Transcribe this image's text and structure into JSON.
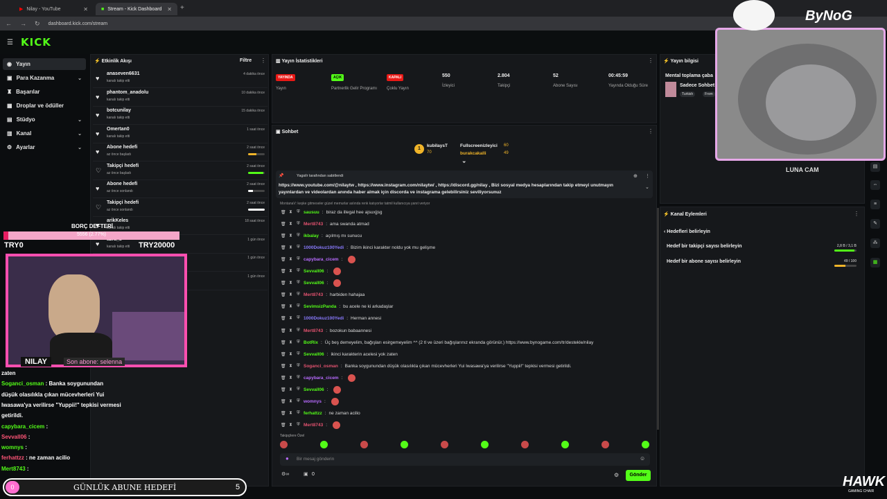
{
  "browser": {
    "tabs": [
      {
        "label": "Nilay - YouTube",
        "active": false
      },
      {
        "label": "Stream - Kick Dashboard",
        "active": true
      }
    ],
    "address": "dashboard.kick.com/stream"
  },
  "brand": {
    "logo": "KICK",
    "accent": "#53fc18"
  },
  "sidebar": {
    "items": [
      {
        "label": "Yayın",
        "icon": "broadcast-icon",
        "active": true,
        "chevron": false
      },
      {
        "label": "Para Kazanma",
        "icon": "dollar-icon",
        "chevron": true
      },
      {
        "label": "Başarılar",
        "icon": "trophy-icon",
        "chevron": false
      },
      {
        "label": "Droplar ve ödüller",
        "icon": "gift-icon",
        "chevron": false
      },
      {
        "label": "Stüdyo",
        "icon": "studio-icon",
        "chevron": true
      },
      {
        "label": "Kanal",
        "icon": "channel-icon",
        "chevron": true
      },
      {
        "label": "Ayarlar",
        "icon": "gear-icon",
        "chevron": true
      }
    ]
  },
  "activity": {
    "title": "Etkinlik Akışı",
    "filter": "Filtre",
    "items": [
      {
        "name": "anaseven6631",
        "sub": "kanalı takip etti",
        "time": "4 dakika önce",
        "icon": "heart-icon"
      },
      {
        "name": "phantom_anadolu",
        "sub": "kanalı takip etti",
        "time": "10 dakika önce",
        "icon": "heart-icon"
      },
      {
        "name": "botcunilay",
        "sub": "kanalı takip etti",
        "time": "15 dakika önce",
        "icon": "heart-icon"
      },
      {
        "name": "Omertan0",
        "sub": "kanalı takip etti",
        "time": "1 saat önce",
        "icon": "heart-icon"
      },
      {
        "name": "Abone hedefi",
        "sub": "az önce başladı",
        "time": "2 saat önce",
        "icon": "heart-icon",
        "progress": 0.5,
        "color": "#f0b429"
      },
      {
        "name": "Takipçi hedefi",
        "sub": "az önce başladı",
        "time": "2 saat önce",
        "icon": "heart-outline-icon",
        "progress": 0.9,
        "color": "#53fc18"
      },
      {
        "name": "Abone hedefi",
        "sub": "az önce sonlandı",
        "time": "2 saat önce",
        "icon": "heart-icon",
        "progress": 0.3,
        "color": "#ffffff"
      },
      {
        "name": "Takipçi hedefi",
        "sub": "az önce sonlandı",
        "time": "2 saat önce",
        "icon": "heart-outline-icon",
        "progress": 1.0,
        "color": "#ffffff"
      },
      {
        "name": "arikKeles",
        "sub": "kanalı takip etti",
        "time": "18 saat önce",
        "icon": "heart-icon"
      },
      {
        "name": "azra_s",
        "sub": "kanalı takip etti",
        "time": "1 gün önce",
        "icon": "heart-icon"
      },
      {
        "name": "",
        "sub": "",
        "time": "1 gün önce",
        "icon": "heart-icon"
      },
      {
        "name": "",
        "sub": "",
        "time": "1 gün önce",
        "icon": "heart-icon"
      }
    ]
  },
  "stats": {
    "title": "Yayın İstatistikleri",
    "items": [
      {
        "value": "YAYINDA",
        "label": "Yayın",
        "badge": true,
        "color": "#e91916"
      },
      {
        "value": "AÇIK",
        "label": "Partnerlik Gelir Programı",
        "badge": true,
        "color": "#53fc18"
      },
      {
        "value": "KAPALI",
        "label": "Çoklu Yayın",
        "badge": true,
        "color": "#e91916"
      },
      {
        "value": "550",
        "label": "İzleyici"
      },
      {
        "value": "2.804",
        "label": "Takipçi"
      },
      {
        "value": "52",
        "label": "Abone Sayısı"
      },
      {
        "value": "00:45:59",
        "label": "Yayında Olduğu Süre"
      }
    ]
  },
  "info": {
    "title": "Yayın bilgisi",
    "stream_title": "Mental toplama çaba",
    "category": "Sadece Sohbet",
    "tags": [
      "Turkish",
      "From"
    ]
  },
  "chat": {
    "title": "Sohbet",
    "leaderboard": [
      {
        "name": "kubilaysT",
        "count": "70"
      },
      {
        "name": "Fullscreenizleyici",
        "count": "60"
      },
      {
        "name": "burakcakalli",
        "count": "49"
      }
    ],
    "pinned_by": "Yagsilr tarafından sabitlendi",
    "pinned_text": "https://www.youtube.com/@nilaytw , https://www.instagram.com/nilaytw/ , https://discord.gg/nilay , Bizi sosyal medya hesaplarından takip etmeyi unutmayın yayınlardan ve videolardan anında haber almak için discorda ve instagrama gelebilirsiniz seviliyorsunuz",
    "reply_note": "MontanaV: keşke gitmeseler güzel memurlar aslında renk katıyorlar tatmil kullanıcıya yanıt veriyor",
    "messages": [
      {
        "user": "sausuu",
        "color": "#53fc18",
        "text": "biraz da illegal hee ajsuxjjsg"
      },
      {
        "user": "Mert8743",
        "color": "#e2526f",
        "text": "ama swanda atmad"
      },
      {
        "user": "ikbalay",
        "color": "#53fc18",
        "text": "açılmış mı sunucu"
      },
      {
        "user": "1000Dokuz100Yedi",
        "color": "#8a7bff",
        "text": "Bizim ikinci karakter noldu yok mu gelişme"
      },
      {
        "user": "capybara_cicem",
        "color": "#b86bff",
        "text": ""
      },
      {
        "user": "Sevvall06",
        "color": "#53fc18",
        "text": ""
      },
      {
        "user": "Sevvall06",
        "color": "#53fc18",
        "text": ""
      },
      {
        "user": "Mert8743",
        "color": "#e2526f",
        "text": "harbiden hahajaa"
      },
      {
        "user": "SevimsizPanda",
        "color": "#53fc18",
        "text": "bu acele ne ki arkadaşlar"
      },
      {
        "user": "1000Dokuz100Yedi",
        "color": "#8a7bff",
        "text": "Herman annesi"
      },
      {
        "user": "Mert8743",
        "color": "#e2526f",
        "text": "bozokun babaannesi"
      },
      {
        "user": "BotRix",
        "color": "#53fc18",
        "text": "Üç beş demeyelim, bağışları esirgemeyelim ^^ (2 tl ve üzeri bağışlarınız ekranda görünür.) https://www.bynogame.com/tr/destekle/nilay"
      },
      {
        "user": "Sevvall06",
        "color": "#53fc18",
        "text": "ikinci karakterin acelesi yok zaten"
      },
      {
        "user": "Soganci_osman",
        "color": "#e2526f",
        "text": "Banka soygunundan düşük olasılıkla çıkan mücevherleri Yui Iwasawa'ya verilirse \"Yuppii!\" tepkisi vermesi getirildi."
      },
      {
        "user": "capybara_cicem",
        "color": "#b86bff",
        "text": ""
      },
      {
        "user": "Sevvall06",
        "color": "#53fc18",
        "text": ""
      },
      {
        "user": "womnys",
        "color": "#b86bff",
        "text": ""
      },
      {
        "user": "ferhattzz",
        "color": "#53fc18",
        "text": "ne zaman acilio"
      },
      {
        "user": "Mert8743",
        "color": "#e2526f",
        "text": ""
      }
    ],
    "emote_label": "Takipçilere Özel",
    "input_placeholder": "Bir mesaj gönderin",
    "send_label": "Gönder",
    "points": "0"
  },
  "actions": {
    "title": "Kanal Eylemleri",
    "back_label": "Hedefleri belirleyin",
    "goals": [
      {
        "label": "Hedef bir takipçi sayısı belirleyin",
        "value": "2,8 B / 3,1 B",
        "progress": 0.9,
        "color": "#53fc18"
      },
      {
        "label": "Hedef bir abone sayısı belirleyin",
        "value": "49 / 100",
        "progress": 0.49,
        "color": "#f0b429"
      }
    ]
  },
  "overlay": {
    "debt_title": "BORÇ DEFTERİ",
    "debt_progress": "5556 (2.77%)",
    "debt_fraction": 0.0277,
    "debt_min": "TRY0",
    "debt_max": "TRY20000",
    "streamer": "NILAY",
    "new_sub": "Son abone: selenna",
    "cat_cam": "LUNA CAM",
    "brand": "ByNoG",
    "hawk": "HAWK",
    "hawk_sub": "GAMING CHAIR",
    "daily_goal": "GÜNLÜK ABUNE HEDEFİ",
    "daily_goal_current": "0",
    "daily_goal_target": "5",
    "chat": [
      {
        "user": "",
        "text": "zaten"
      },
      {
        "user": "Soganci_osman",
        "text": "Banka soygunundan"
      },
      {
        "user": "",
        "text": "düşük olasılıkla çıkan mücevherleri Yui"
      },
      {
        "user": "",
        "text": "Iwasawa'ya verilirse \"Yuppii!\" tepkisi vermesi"
      },
      {
        "user": "",
        "text": "getirildi."
      },
      {
        "user": "capybara_cicem",
        "text": ""
      },
      {
        "user": "Sevvall06",
        "text": ""
      },
      {
        "user": "womnys",
        "text": ""
      },
      {
        "user": "ferhattzz",
        "text": "ne zaman acilio"
      },
      {
        "user": "Mert8743",
        "text": ""
      }
    ]
  }
}
